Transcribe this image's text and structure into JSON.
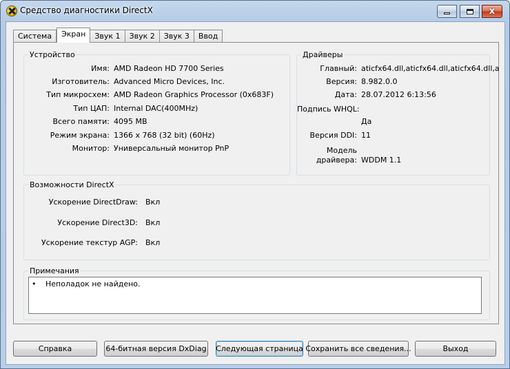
{
  "window": {
    "title": "Средство диагностики DirectX",
    "close_glyph": "x"
  },
  "tabs": [
    "Система",
    "Экран",
    "Звук 1",
    "Звук 2",
    "Звук 3",
    "Ввод"
  ],
  "active_tab": "Экран",
  "device": {
    "title": "Устройство",
    "name_label": "Имя:",
    "name_value": "AMD Radeon HD 7700 Series",
    "manufacturer_label": "Изготовитель:",
    "manufacturer_value": "Advanced Micro Devices, Inc.",
    "chip_label": "Тип микросхем:",
    "chip_value": "AMD Radeon Graphics Processor (0x683F)",
    "dac_label": "Тип ЦАП:",
    "dac_value": "Internal DAC(400MHz)",
    "memory_label": "Всего памяти:",
    "memory_value": "4095 MB",
    "mode_label": "Режим экрана:",
    "mode_value": "1366 x 768 (32 bit) (60Hz)",
    "monitor_label": "Монитор:",
    "monitor_value": "Универсальный монитор PnP"
  },
  "drivers": {
    "title": "Драйверы",
    "main_label": "Главный:",
    "main_value": "aticfx64.dll,aticfx64.dll,aticfx64.dll,a",
    "version_label": "Версия:",
    "version_value": "8.982.0.0",
    "date_label": "Дата:",
    "date_value": "28.07.2012 6:13:56",
    "whql_label": "Подпись WHQL:",
    "whql_value": "Да",
    "ddi_label": "Версия DDI:",
    "ddi_value": "11",
    "model_label_1": "Модель",
    "model_label_2": "драйвера:",
    "model_value": "WDDM 1.1"
  },
  "features": {
    "title": "Возможности DirectX",
    "directdraw_label": "Ускорение DirectDraw:",
    "directdraw_value": "Вкл",
    "direct3d_label": "Ускорение Direct3D:",
    "direct3d_value": "Вкл",
    "agp_label": "Ускорение текстур AGP:",
    "agp_value": "Вкл"
  },
  "notes": {
    "title": "Примечания",
    "bullet": "•",
    "text": "Неполадок не найдено."
  },
  "buttons": {
    "help": "Справка",
    "dxdiag64": "64-битная версия DxDiag",
    "next_page": "Следующая страница",
    "save_all": "Сохранить все сведения...",
    "exit": "Выход"
  }
}
